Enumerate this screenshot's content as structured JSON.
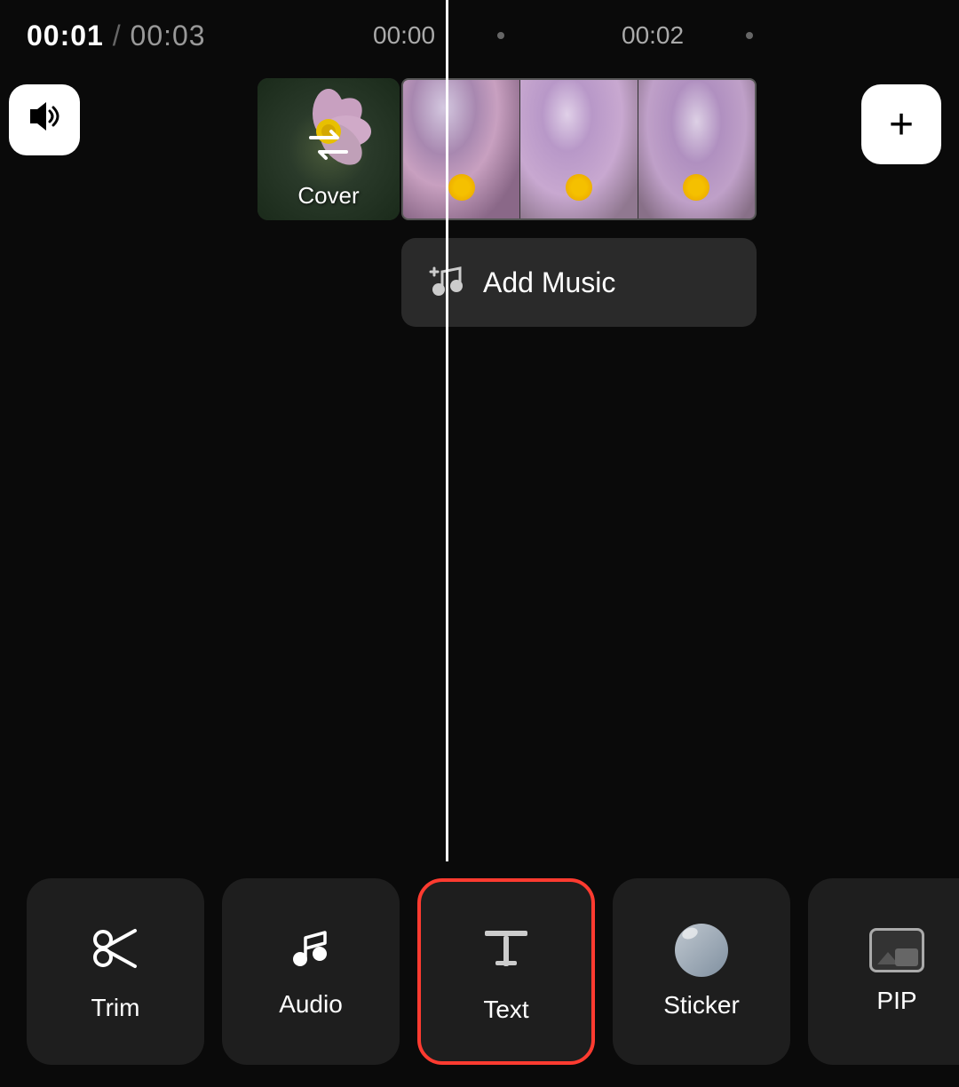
{
  "header": {
    "time_current": "00:01",
    "time_separator": "/",
    "time_total": "00:03",
    "marker_00": "00:00",
    "marker_02": "00:02"
  },
  "timeline": {
    "cover_label": "Cover",
    "add_music_label": "Add Music"
  },
  "toolbar": {
    "items": [
      {
        "id": "trim",
        "label": "Trim",
        "icon": "scissors"
      },
      {
        "id": "audio",
        "label": "Audio",
        "icon": "note"
      },
      {
        "id": "text",
        "label": "Text",
        "icon": "text-t",
        "active": true
      },
      {
        "id": "sticker",
        "label": "Sticker",
        "icon": "sticker"
      },
      {
        "id": "pip",
        "label": "PIP",
        "icon": "pip"
      }
    ]
  },
  "colors": {
    "accent": "#ff3b30",
    "background": "#0a0a0a",
    "toolbar_item": "#1e1e1e",
    "text_primary": "#ffffff",
    "playhead": "#ffffff"
  }
}
